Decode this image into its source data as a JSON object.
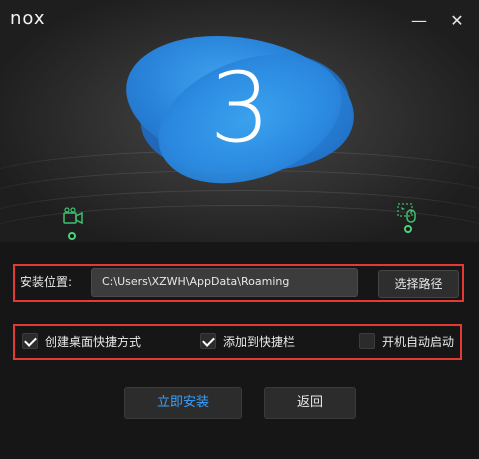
{
  "app": {
    "logo_text": "nox",
    "minimize_symbol": "—",
    "close_symbol": "✕"
  },
  "hero": {
    "countdown": "3",
    "left_icon": "video-camera-icon",
    "right_icon": "mouse-screen-icon",
    "accent_color": "#2a86db",
    "indicator_color": "#4cd07a"
  },
  "install_path": {
    "label": "安装位置:",
    "value": "C:\\Users\\XZWH\\AppData\\Roaming",
    "browse_label": "选择路径"
  },
  "options": [
    {
      "label": "创建桌面快捷方式",
      "checked": true
    },
    {
      "label": "添加到快捷栏",
      "checked": true
    },
    {
      "label": "开机自动启动",
      "checked": false
    }
  ],
  "actions": {
    "install_label": "立即安装",
    "back_label": "返回",
    "install_color": "#3aa0ff"
  },
  "highlight_color": "#e53935"
}
